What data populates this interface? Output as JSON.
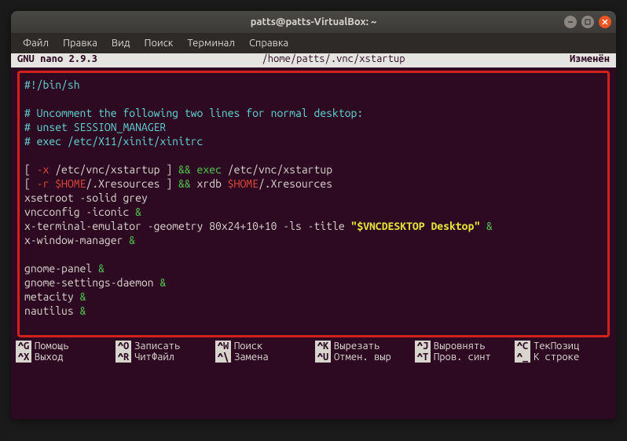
{
  "titlebar": {
    "title": "patts@patts-VirtualBox: ~"
  },
  "menubar": {
    "items": [
      "Файл",
      "Правка",
      "Вид",
      "Поиск",
      "Терминал",
      "Справка"
    ]
  },
  "nano_header": {
    "app": "GNU nano 2.9.3",
    "file": "/home/patts/.vnc/xstartup",
    "status": "Изменён"
  },
  "editor": {
    "lines": [
      [
        {
          "c": "cyan",
          "t": "#!/bin/sh"
        }
      ],
      [],
      [
        {
          "c": "cyan",
          "t": "# Uncomment the following two lines for normal desktop:"
        }
      ],
      [
        {
          "c": "cyan",
          "t": "# unset SESSION_MANAGER"
        }
      ],
      [
        {
          "c": "cyan",
          "t": "# exec /etc/X11/xinit/xinitrc"
        }
      ],
      [],
      [
        {
          "c": "white",
          "t": "[ "
        },
        {
          "c": "red",
          "t": "-x"
        },
        {
          "c": "white",
          "t": " /etc/vnc/xstartup ] "
        },
        {
          "c": "green",
          "t": "&&"
        },
        {
          "c": "white",
          "t": " "
        },
        {
          "c": "green",
          "t": "exec"
        },
        {
          "c": "white",
          "t": " /etc/vnc/xstartup"
        }
      ],
      [
        {
          "c": "white",
          "t": "[ "
        },
        {
          "c": "red",
          "t": "-r"
        },
        {
          "c": "white",
          "t": " "
        },
        {
          "c": "red",
          "t": "$HOME"
        },
        {
          "c": "white",
          "t": "/.Xresources ] "
        },
        {
          "c": "green",
          "t": "&&"
        },
        {
          "c": "white",
          "t": " xrdb "
        },
        {
          "c": "red",
          "t": "$HOME"
        },
        {
          "c": "white",
          "t": "/.Xresources"
        }
      ],
      [
        {
          "c": "white",
          "t": "xsetroot -solid grey"
        }
      ],
      [
        {
          "c": "white",
          "t": "vncconfig -iconic "
        },
        {
          "c": "green",
          "t": "&"
        }
      ],
      [
        {
          "c": "white",
          "t": "x-terminal-emulator -geometry 80x24+10+10 -ls -title "
        },
        {
          "c": "yellow",
          "t": "\"$VNCDESKTOP Desktop\""
        },
        {
          "c": "white",
          "t": " "
        },
        {
          "c": "green",
          "t": "&"
        }
      ],
      [
        {
          "c": "white",
          "t": "x-window-manager "
        },
        {
          "c": "green",
          "t": "&"
        }
      ],
      [],
      [
        {
          "c": "white",
          "t": "gnome-panel "
        },
        {
          "c": "green",
          "t": "&"
        }
      ],
      [
        {
          "c": "white",
          "t": "gnome-settings-daemon "
        },
        {
          "c": "green",
          "t": "&"
        }
      ],
      [
        {
          "c": "white",
          "t": "metacity "
        },
        {
          "c": "green",
          "t": "&"
        }
      ],
      [
        {
          "c": "white",
          "t": "nautilus "
        },
        {
          "c": "green",
          "t": "&"
        }
      ]
    ]
  },
  "help": {
    "row1": [
      {
        "key": "^G",
        "label": "Помощь"
      },
      {
        "key": "^O",
        "label": "Записать"
      },
      {
        "key": "^W",
        "label": "Поиск"
      },
      {
        "key": "^K",
        "label": "Вырезать"
      },
      {
        "key": "^J",
        "label": "Выровнять"
      },
      {
        "key": "^C",
        "label": "ТекПозиц"
      }
    ],
    "row2": [
      {
        "key": "^X",
        "label": "Выход"
      },
      {
        "key": "^R",
        "label": "ЧитФайл"
      },
      {
        "key": "^\\",
        "label": "Замена"
      },
      {
        "key": "^U",
        "label": "Отмен. выр"
      },
      {
        "key": "^T",
        "label": "Пров. синт"
      },
      {
        "key": "^_",
        "label": "К строке"
      }
    ]
  }
}
